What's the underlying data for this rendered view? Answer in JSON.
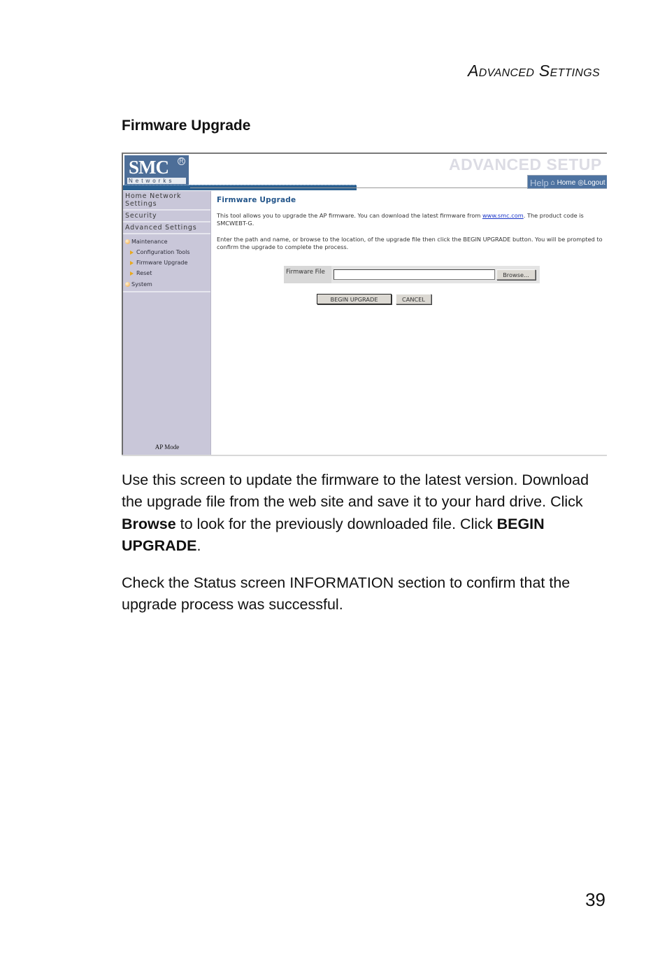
{
  "page": {
    "running_head": {
      "cap1": "A",
      "rest1": "DVANCED",
      "cap2": "S",
      "rest2": "ETTINGS"
    },
    "section_title": "Firmware Upgrade",
    "page_number": "39"
  },
  "screenshot": {
    "logo": {
      "brand": "SMC",
      "registered": "R",
      "sub": "Networks"
    },
    "banner_title": "ADVANCED SETUP",
    "top_links": {
      "help": "Help",
      "home": "Home",
      "logout": "Logout"
    },
    "sidebar": {
      "items": [
        {
          "label": "Home Network Settings"
        },
        {
          "label": "Security"
        },
        {
          "label": "Advanced Settings"
        }
      ],
      "groups": [
        {
          "label": "Maintenance",
          "children": [
            {
              "label": "Configuration Tools"
            },
            {
              "label": "Firmware Upgrade"
            },
            {
              "label": "Reset"
            }
          ]
        },
        {
          "label": "System",
          "children": []
        }
      ],
      "footer": "AP Mode"
    },
    "content": {
      "title": "Firmware Upgrade",
      "para1_before_link": "This tool allows you to upgrade the AP firmware. You can download the latest firmware from ",
      "para1_link": "www.smc.com",
      "para1_after_link": ". The product code is SMCWEBT-G.",
      "para2": "Enter the path and name, or browse to the location, of the upgrade file then click the BEGIN UPGRADE button. You will be prompted to confirm the upgrade to complete the process.",
      "firmware_file_label": "Firmware File",
      "firmware_file_value": "",
      "browse_label": "Browse...",
      "begin_upgrade_label": "BEGIN UPGRADE",
      "cancel_label": "CANCEL"
    }
  },
  "body": {
    "p1_a": "Use this screen to update the firmware to the latest version. Download the upgrade file from the web site and save it to your hard drive. Click ",
    "p1_b": "Browse",
    "p1_c": " to look for the previously downloaded file. Click ",
    "p1_d": "BEGIN UPGRADE",
    "p1_e": ".",
    "p2": "Check the Status screen INFORMATION section to confirm that the upgrade process was successful."
  }
}
